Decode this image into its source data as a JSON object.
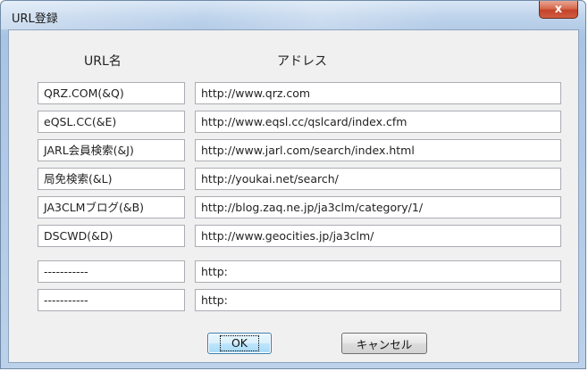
{
  "window": {
    "title": "URL登録",
    "close_glyph": "x"
  },
  "headers": {
    "name": "URL名",
    "address": "アドレス"
  },
  "rows": [
    {
      "name": "QRZ.COM(&Q)",
      "address": "http://www.qrz.com"
    },
    {
      "name": "eQSL.CC(&E)",
      "address": "http://www.eqsl.cc/qslcard/index.cfm"
    },
    {
      "name": "JARL会員検索(&J)",
      "address": "http://www.jarl.com/search/index.html"
    },
    {
      "name": "局免検索(&L)",
      "address": "http://youkai.net/search/"
    },
    {
      "name": "JA3CLMブログ(&B)",
      "address": "http://blog.zaq.ne.jp/ja3clm/category/1/"
    },
    {
      "name": "DSCWD(&D)",
      "address": "http://www.geocities.jp/ja3clm/"
    },
    {
      "name": "-----------",
      "address": "http:"
    },
    {
      "name": "-----------",
      "address": "http:"
    }
  ],
  "buttons": {
    "ok": "OK",
    "cancel": "キャンセル"
  }
}
